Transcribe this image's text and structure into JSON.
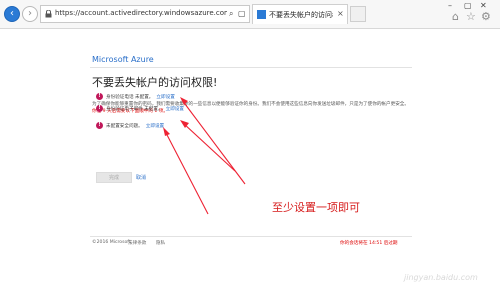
{
  "browser": {
    "url": "https://account.activedirectory.windowsazure.com/passwordreset/rej",
    "tab_title": "不要丢失帐户的访问权限!",
    "close_glyph": "×"
  },
  "page": {
    "brand": "Microsoft Azure",
    "title": "不要丢失帐户的访问权限!",
    "description": "为了确保你能够重置你的密码，我们需要收集你的一些信息以便能够验证你的身份。我们不会使用这些信息向你发送垃圾邮件，只是为了使你的帐户更安全。",
    "description_red": "你在 9 天后需要以下面顺中的 1 项。",
    "items": [
      {
        "text": "身份验证电话 未配置。",
        "link": "立即设置"
      },
      {
        "text": "身份验证电子邮件 未配置。",
        "link": "立即设置"
      },
      {
        "text": "未配置安全问题。",
        "link": "立即设置"
      }
    ],
    "next_button": "完成",
    "cancel_link": "取消",
    "annotation": "至少设置一项即可",
    "footer": {
      "copyright": "©2016 Microsoft",
      "links": [
        "法律条款",
        "隐私"
      ],
      "note": "你的会话将在 14:51 后过期"
    },
    "watermark": "jingyan.baidu.com"
  },
  "colors": {
    "accent": "#2a6fc9",
    "alert": "#c0185a",
    "annotation": "#d61a1a"
  }
}
